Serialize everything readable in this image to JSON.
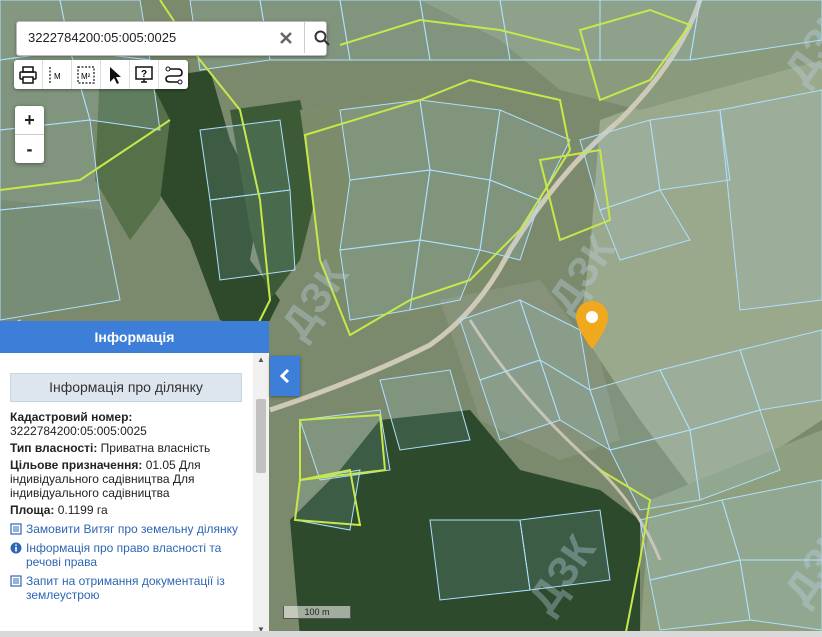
{
  "search": {
    "value": "3222784200:05:005:0025"
  },
  "toolbar": {
    "tools": [
      "print-icon",
      "measure-line-icon",
      "measure-area-icon",
      "pointer-icon",
      "info-screen-icon",
      "route-icon"
    ],
    "measure_line_label": "M",
    "measure_area_label": "M²"
  },
  "zoom": {
    "in_label": "+",
    "out_label": "-"
  },
  "panel": {
    "title": "Інформація",
    "subtitle": "Інформація про ділянку",
    "cadastral_label": "Кадастровий номер:",
    "cadastral_value": "3222784200:05:005:0025",
    "ownership_label": "Тип власності:",
    "ownership_value": "Приватна власність",
    "purpose_label": "Цільове призначення:",
    "purpose_value": "01.05 Для індивідуального садівництва Для індивідуального садівництва",
    "area_label": "Площа:",
    "area_value": "0.1199 га",
    "links": [
      "Замовити Витяг про земельну ділянку",
      "Інформація про право власності та речові права",
      "Запит на отримання документації із землеустрою"
    ]
  },
  "scale_label": "100 m",
  "colors": {
    "accent": "#3d7fd8",
    "marker": "#f2a81d",
    "parcel": "#aee0ff",
    "boundary": "#c6e84a"
  }
}
